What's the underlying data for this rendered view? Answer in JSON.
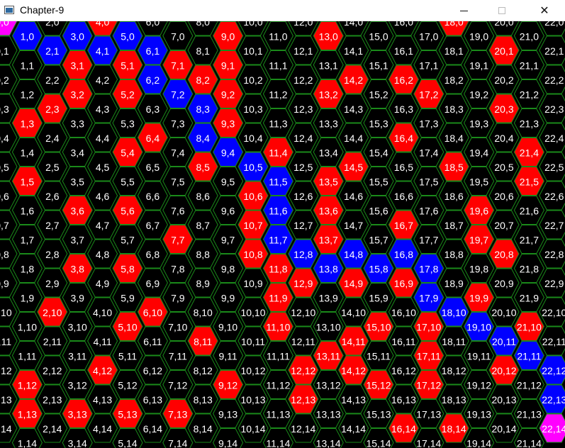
{
  "window": {
    "title": "Chapter-9",
    "minimize_symbol": "—",
    "close_symbol": "✕"
  },
  "colors": {
    "background": "#000000",
    "grid_line": "#1a8a1a",
    "red": "#ff0000",
    "blue": "#0000ff",
    "magenta": "#ff00ff",
    "text": "#ffffff"
  },
  "grid": {
    "columns": [
      0,
      22
    ],
    "rows": [
      0,
      14
    ],
    "label_format": "col,row"
  },
  "cells": {
    "red": [
      "4,0",
      "9,0",
      "13,0",
      "18,0",
      "3,1",
      "5,1",
      "7,1",
      "9,1",
      "20,1",
      "3,2",
      "5,2",
      "8,2",
      "9,2",
      "13,2",
      "14,2",
      "16,2",
      "17,2",
      "2,3",
      "9,3",
      "20,3",
      "1,3",
      "6,4",
      "16,4",
      "11,4",
      "5,4",
      "21,4",
      "8,5",
      "14,5",
      "18,5",
      "13,5",
      "1,5",
      "21,5",
      "10,6",
      "3,6",
      "5,6",
      "13,6",
      "19,6",
      "10,7",
      "16,7",
      "7,7",
      "13,7",
      "19,7",
      "10,8",
      "3,8",
      "5,8",
      "11,8",
      "20,8",
      "12,9",
      "14,9",
      "16,9",
      "11,9",
      "19,9",
      "2,10",
      "6,10",
      "15,10",
      "21,10",
      "5,10",
      "11,10",
      "17,10",
      "8,11",
      "14,11",
      "13,11",
      "17,11",
      "4,12",
      "12,12",
      "14,12",
      "20,12",
      "1,12",
      "9,12",
      "15,12",
      "17,12",
      "12,13",
      "1,13",
      "3,13",
      "5,13",
      "7,13",
      "16,14",
      "18,14"
    ],
    "blue": [
      "1,0",
      "3,0",
      "5,0",
      "2,1",
      "4,1",
      "6,1",
      "6,2",
      "7,2",
      "8,3",
      "8,4",
      "9,4",
      "10,5",
      "11,5",
      "11,6",
      "11,7",
      "12,8",
      "13,8",
      "14,8",
      "15,8",
      "16,8",
      "17,8",
      "17,9",
      "18,10",
      "19,10",
      "20,11",
      "21,11",
      "22,12",
      "22,13"
    ],
    "magenta": [
      "0,0",
      "22,14"
    ]
  }
}
